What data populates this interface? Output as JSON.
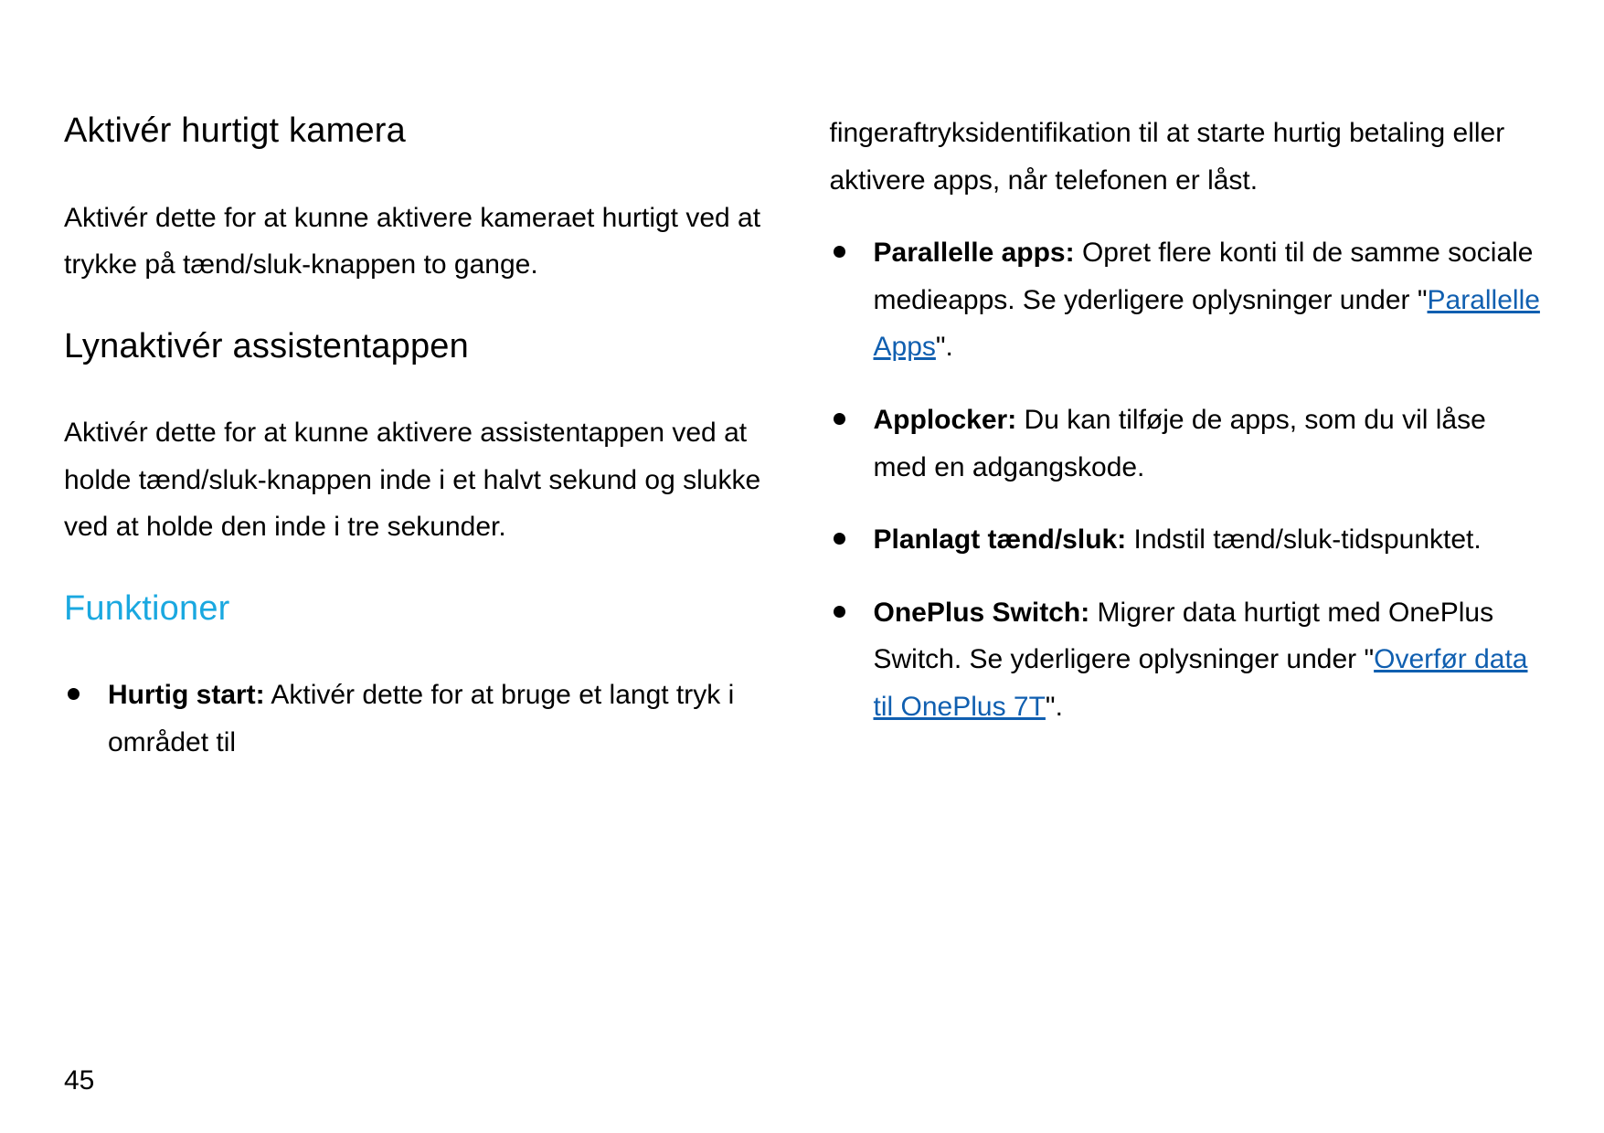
{
  "page_number": "45",
  "left": {
    "section1": {
      "heading": "Aktivér hurtigt kamera",
      "paragraph": "Aktivér dette for at kunne aktivere kameraet hurtigt ved at trykke på tænd/sluk-knappen to gange."
    },
    "section2": {
      "heading": "Lynaktivér assistentappen",
      "paragraph": "Aktivér dette for at kunne aktivere assistentappen ved at holde tænd/sluk-knappen inde i et halvt sekund og slukke ved at holde den inde i tre sekunder."
    },
    "section3": {
      "heading": "Funktioner",
      "item1": {
        "label": "Hurtig start:",
        "text": " Aktivér dette for at bruge et langt tryk i området til "
      }
    }
  },
  "right": {
    "continuation": "fingeraftryksidentifikation til at starte hurtig betaling eller aktivere apps, når telefonen er låst.",
    "item2": {
      "label": "Parallelle apps:",
      "text_before_link": " Opret flere konti til de samme sociale medieapps. Se yderligere oplysninger under \"",
      "link": "Parallelle Apps",
      "text_after_link": "\"."
    },
    "item3": {
      "label": "Applocker:",
      "text": " Du kan tilføje de apps, som du vil låse med en adgangskode."
    },
    "item4": {
      "label": "Planlagt tænd/sluk:",
      "text": " Indstil tænd/sluk-tidspunktet."
    },
    "item5": {
      "label": "OnePlus Switch:",
      "text_before_link": " Migrer data hurtigt med OnePlus Switch. Se yderligere oplysninger under \"",
      "link": "Overfør data til OnePlus 7T",
      "text_after_link": "\"."
    }
  }
}
